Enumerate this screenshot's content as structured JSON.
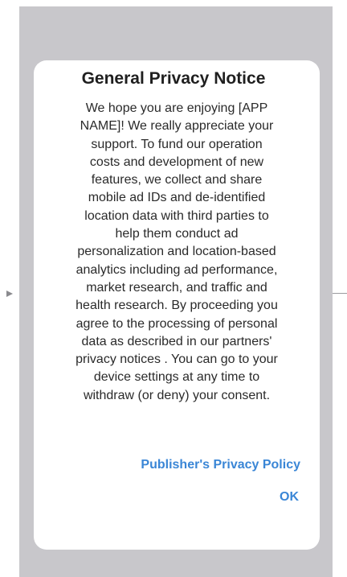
{
  "dialog": {
    "title": "General Privacy Notice",
    "body": "We hope you are enjoying [APP\nNAME]! We really appreciate your\nsupport.  To fund our operation\ncosts and development of new\nfeatures, we collect and share\nmobile  ad IDs and de-identified\nlocation data with third parties  to\nhelp them conduct ad\npersonalization and location-based\nanalytics including ad performance,\nmarket research, and traffic and\nhealth research.  By proceeding you\nagree to the processing of personal\ndata as described in our partners'\nprivacy notices . You can go to your\ndevice settings  at any time to\nwithdraw (or deny) your consent.",
    "policy_link_label": "Publisher's Privacy Policy",
    "ok_label": "OK"
  },
  "colors": {
    "backdrop": "#c8c7cb",
    "dialog_background": "#ffffff",
    "link": "#3a86d6",
    "title_text": "#1f1f1f",
    "body_text": "#2a2a2a"
  }
}
